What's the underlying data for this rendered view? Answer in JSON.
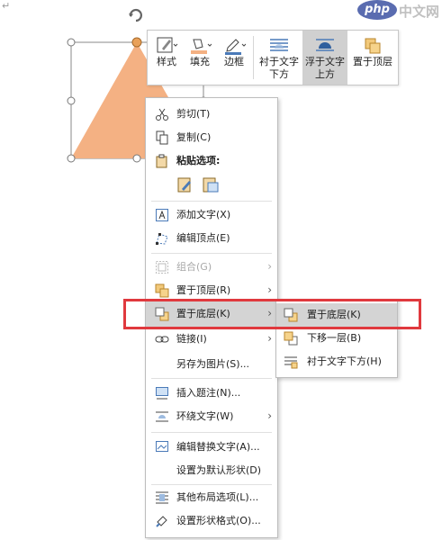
{
  "document": {
    "paragraph_mark": "↵"
  },
  "watermark": {
    "logo": "php",
    "site": "中文网"
  },
  "colors": {
    "shape_fill": "#F4B183",
    "highlight_border": "#E0393E",
    "menu_highlight": "#D4D4D4"
  },
  "mini_toolbar": {
    "style": "样式",
    "fill": "填充",
    "outline": "边框",
    "behind_text_line1": "衬于文字",
    "behind_text_line2": "下方",
    "in_front_line1": "浮于文字",
    "in_front_line2": "上方",
    "bring_to_front": "置于顶层"
  },
  "context_menu": {
    "cut": "剪切(T)",
    "copy": "复制(C)",
    "paste_options": "粘贴选项:",
    "add_text": "添加文字(X)",
    "edit_points": "编辑顶点(E)",
    "group": "组合(G)",
    "bring_to_front": "置于顶层(R)",
    "send_to_back": "置于底层(K)",
    "link": "链接(I)",
    "save_as_picture": "另存为图片(S)...",
    "insert_caption": "插入题注(N)...",
    "wrap_text": "环绕文字(W)",
    "edit_alt_text": "编辑替换文字(A)...",
    "set_default_shape": "设置为默认形状(D)",
    "more_layout": "其他布局选项(L)...",
    "format_shape": "设置形状格式(O)..."
  },
  "submenu": {
    "send_to_back": "置于底层(K)",
    "send_backward": "下移一层(B)",
    "send_behind_text": "衬于文字下方(H)"
  }
}
